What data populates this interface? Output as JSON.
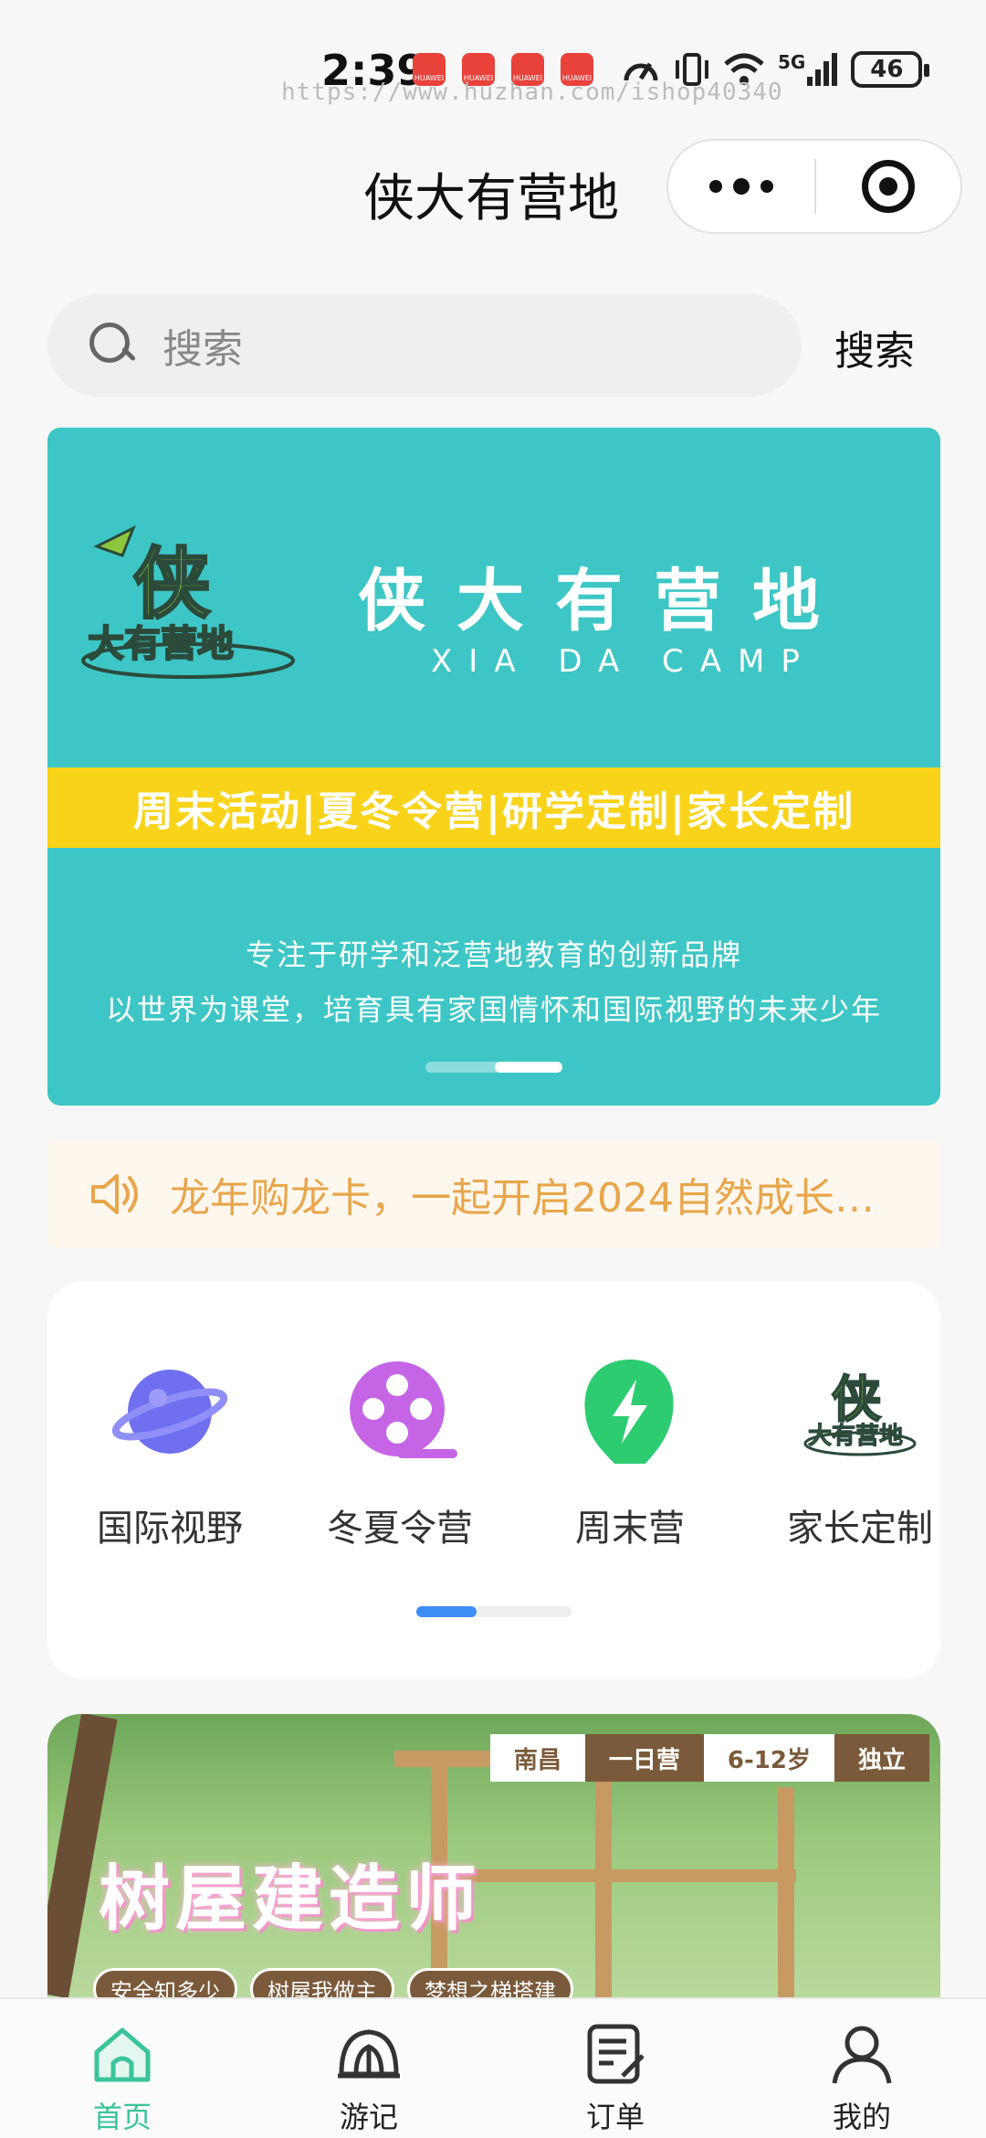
{
  "status_bar": {
    "time": "2:39",
    "notif_brand": "HUAWEI",
    "network": "5G",
    "battery": "46",
    "watermark": "https://www.huzhan.com/ishop40340"
  },
  "header": {
    "title": "侠大有营地"
  },
  "search": {
    "placeholder": "搜索",
    "button_label": "搜索"
  },
  "banner": {
    "logo_text": "侠 大有营地",
    "title": "侠大有营地",
    "subtitle": "XIA DA CAMP",
    "strip": "周末活动|夏冬令营|研学定制|家长定制",
    "line1": "专注于研学和泛营地教育的创新品牌",
    "line2": "以世界为课堂，培育具有家国情怀和国际视野的未来少年",
    "slide_count": 2,
    "active_slide": 2
  },
  "notice": {
    "icon": "speaker-icon",
    "text": "龙年购龙卡，一起开启2024自然成长…"
  },
  "categories": {
    "items": [
      {
        "label": "国际视野",
        "icon": "planet-icon",
        "color": "#6f6ff0"
      },
      {
        "label": "冬夏令营",
        "icon": "film-reel-icon",
        "color": "#c565e6"
      },
      {
        "label": "周末营",
        "icon": "lightning-icon",
        "color": "#2ecc71"
      },
      {
        "label": "家长定制",
        "icon": "camp-logo-icon",
        "color": "#8dc63f"
      }
    ],
    "page": 1,
    "page_count": 2
  },
  "activity": {
    "tags": [
      "南昌",
      "一日营",
      "6-12岁",
      "独立"
    ],
    "title": "树屋建造师",
    "sub_tags": [
      "安全知多少",
      "树屋我做主",
      "梦想之梯搭建"
    ]
  },
  "tab_bar": {
    "items": [
      {
        "label": "首页",
        "icon": "home-icon",
        "active": true
      },
      {
        "label": "游记",
        "icon": "tent-icon",
        "active": false
      },
      {
        "label": "订单",
        "icon": "order-icon",
        "active": false
      },
      {
        "label": "我的",
        "icon": "profile-icon",
        "active": false
      }
    ],
    "active_color": "#3ac49a"
  }
}
